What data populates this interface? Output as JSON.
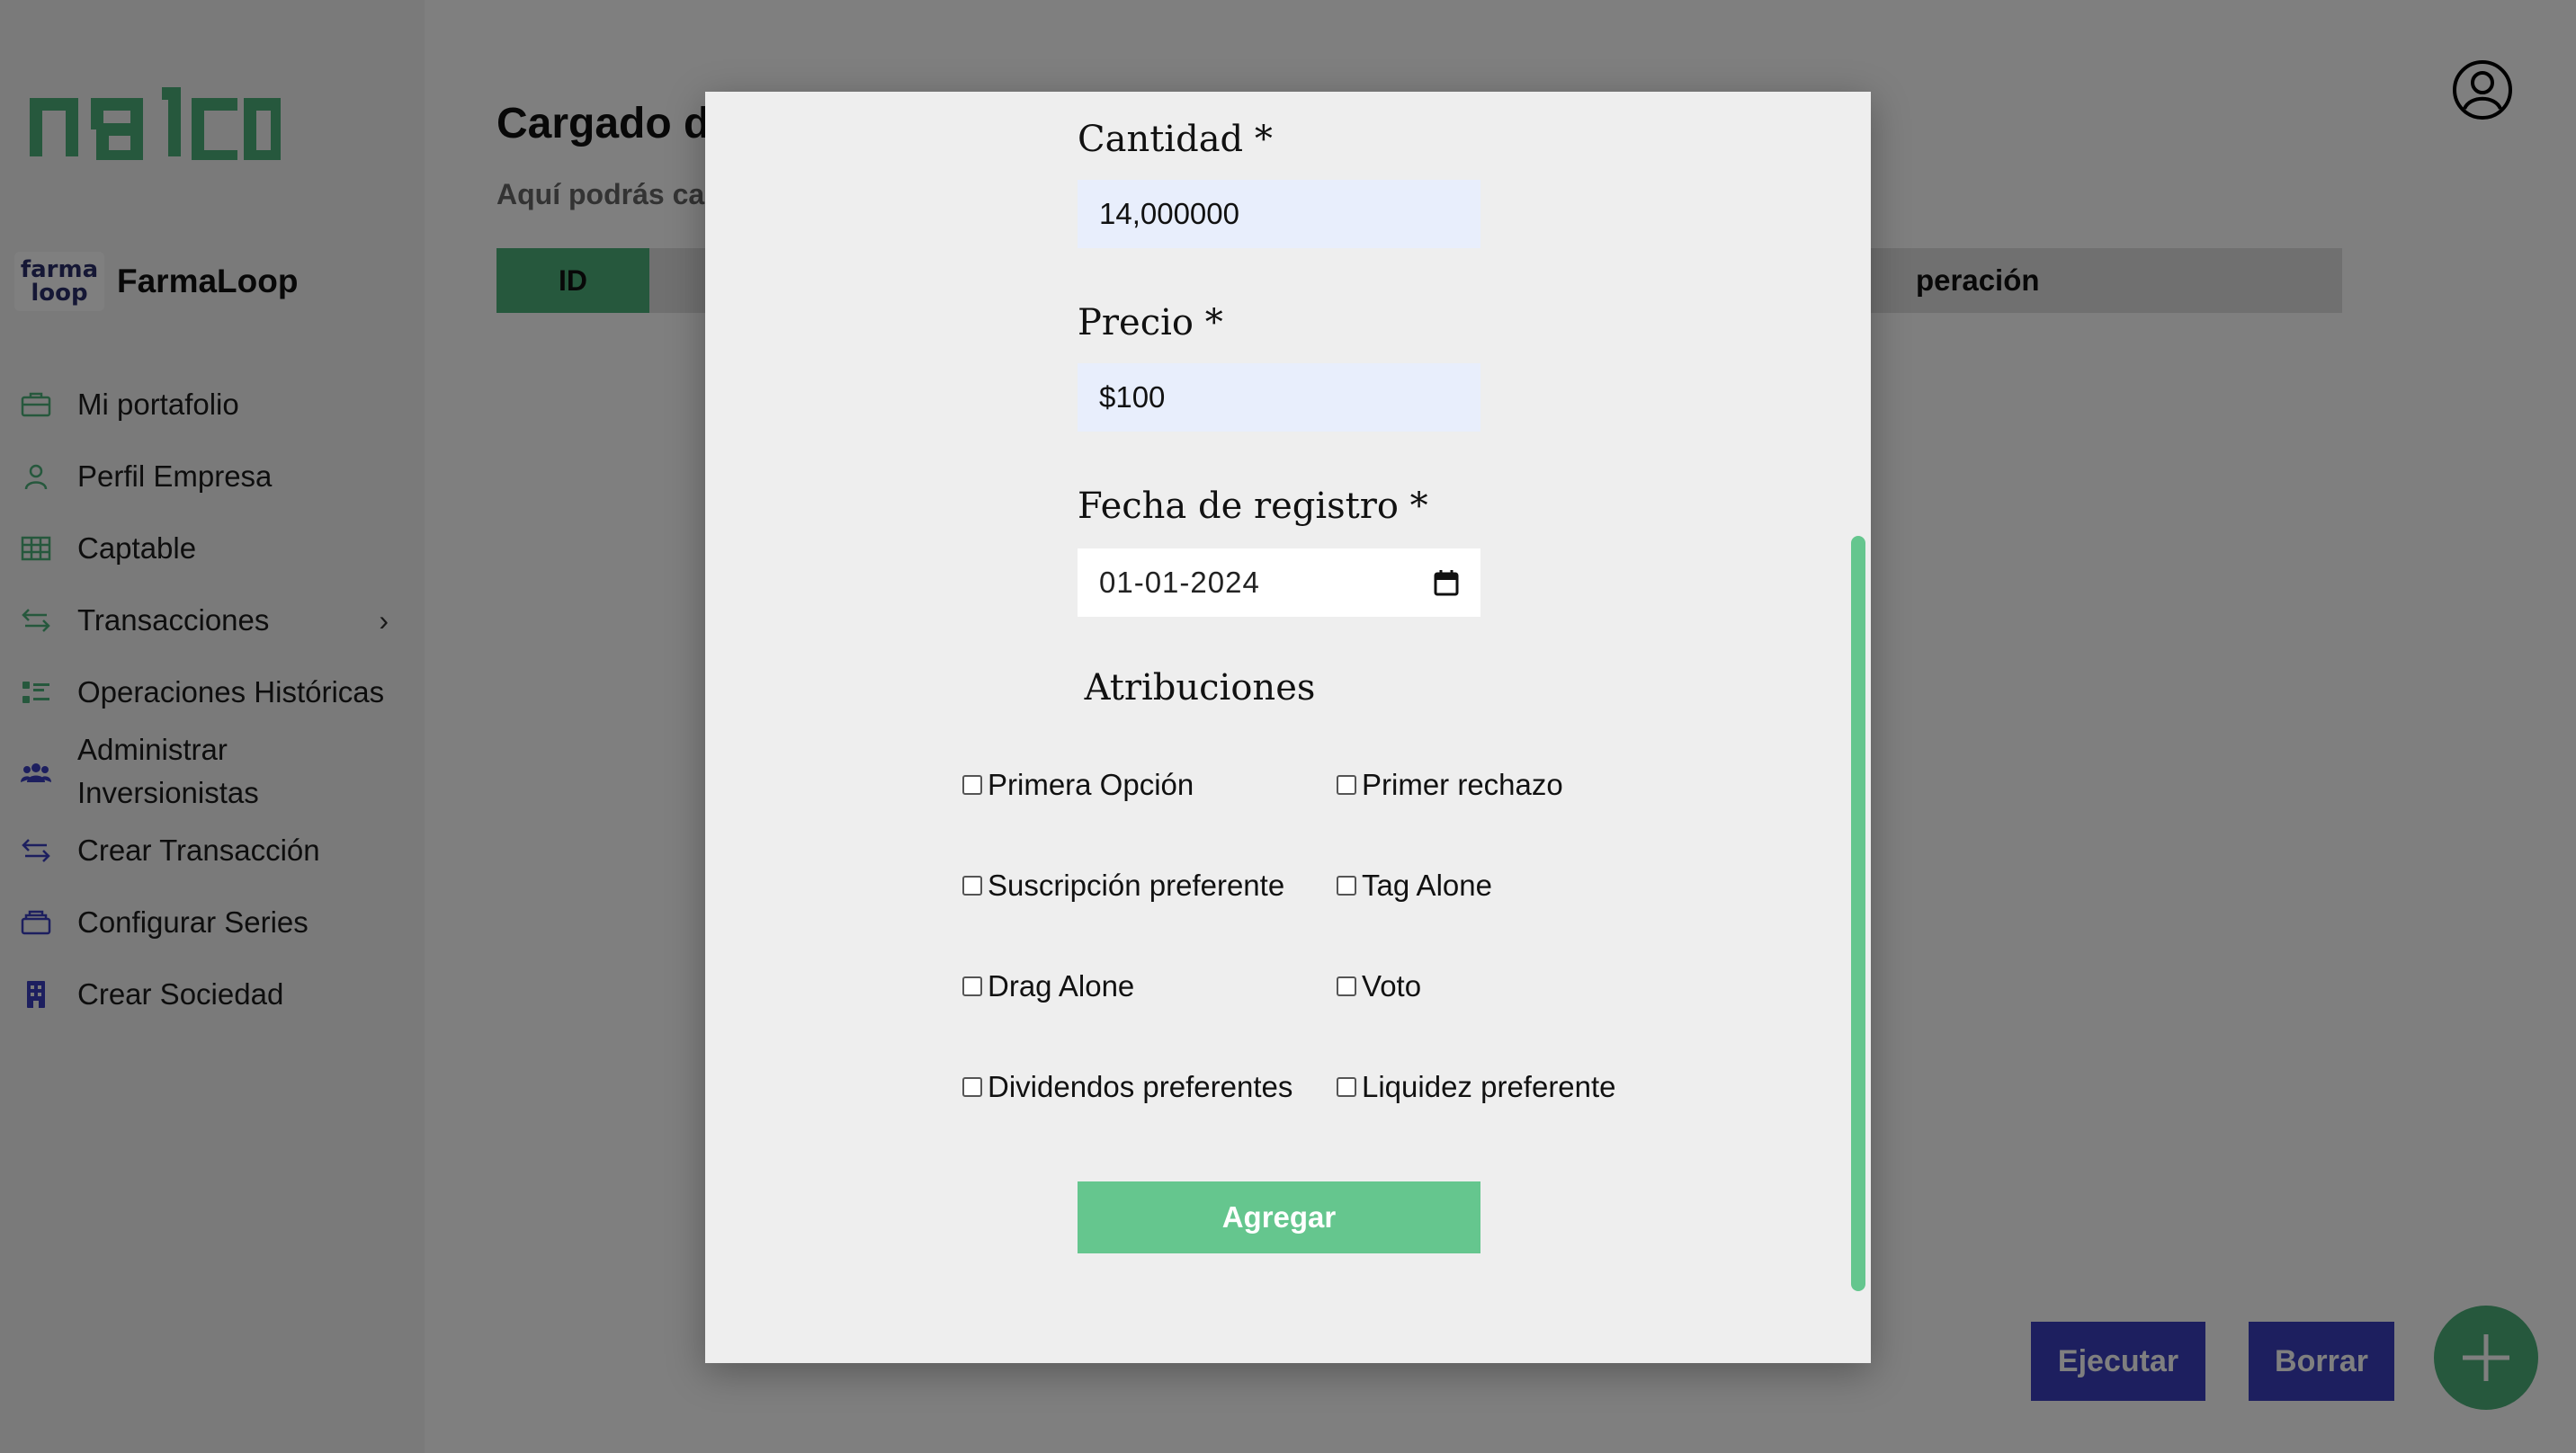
{
  "sidebar": {
    "logo_text": "nalco",
    "company": {
      "logo_text": "farma loop",
      "name": "FarmaLoop"
    },
    "items": [
      {
        "label": "Mi portafolio",
        "icon": "briefcase-icon"
      },
      {
        "label": "Perfil Empresa",
        "icon": "user-icon"
      },
      {
        "label": "Captable",
        "icon": "table-icon"
      },
      {
        "label": "Transacciones",
        "icon": "transfer-icon"
      },
      {
        "label": "Operaciones Históricas",
        "icon": "list-icon"
      },
      {
        "label": "Administrar Inversionistas",
        "icon": "users-icon"
      },
      {
        "label": "Crear Transacción",
        "icon": "transfer-icon"
      },
      {
        "label": "Configurar Series",
        "icon": "layers-icon"
      },
      {
        "label": "Crear Sociedad",
        "icon": "building-icon"
      }
    ],
    "chevron": "›"
  },
  "main": {
    "title": "Cargado d",
    "subtitle": "Aquí podrás ca",
    "table": {
      "col_id": "ID",
      "col_op": "peración"
    },
    "buttons": {
      "ejecutar": "Ejecutar",
      "borrar": "Borrar"
    }
  },
  "modal": {
    "cantidad": {
      "label": "Cantidad *",
      "value": "14,000000"
    },
    "precio": {
      "label": "Precio *",
      "value": "$100"
    },
    "fecha": {
      "label": "Fecha de registro *",
      "value": "01-01-2024"
    },
    "atribuciones": {
      "title": "Atribuciones",
      "options": [
        {
          "label": "Primera Opción",
          "checked": false
        },
        {
          "label": "Primer rechazo",
          "checked": false
        },
        {
          "label": "Suscripción preferente",
          "checked": false
        },
        {
          "label": "Tag Alone",
          "checked": false
        },
        {
          "label": "Drag Alone",
          "checked": false
        },
        {
          "label": "Voto",
          "checked": false
        },
        {
          "label": "Dividendos preferentes",
          "checked": false
        },
        {
          "label": "Liquidez preferente",
          "checked": false
        }
      ]
    },
    "submit_label": "Agregar"
  },
  "colors": {
    "brand_green": "#4db07a",
    "button_green": "#65c68e",
    "action_blue": "#3a3fbf",
    "input_bg": "#e8eefc"
  }
}
